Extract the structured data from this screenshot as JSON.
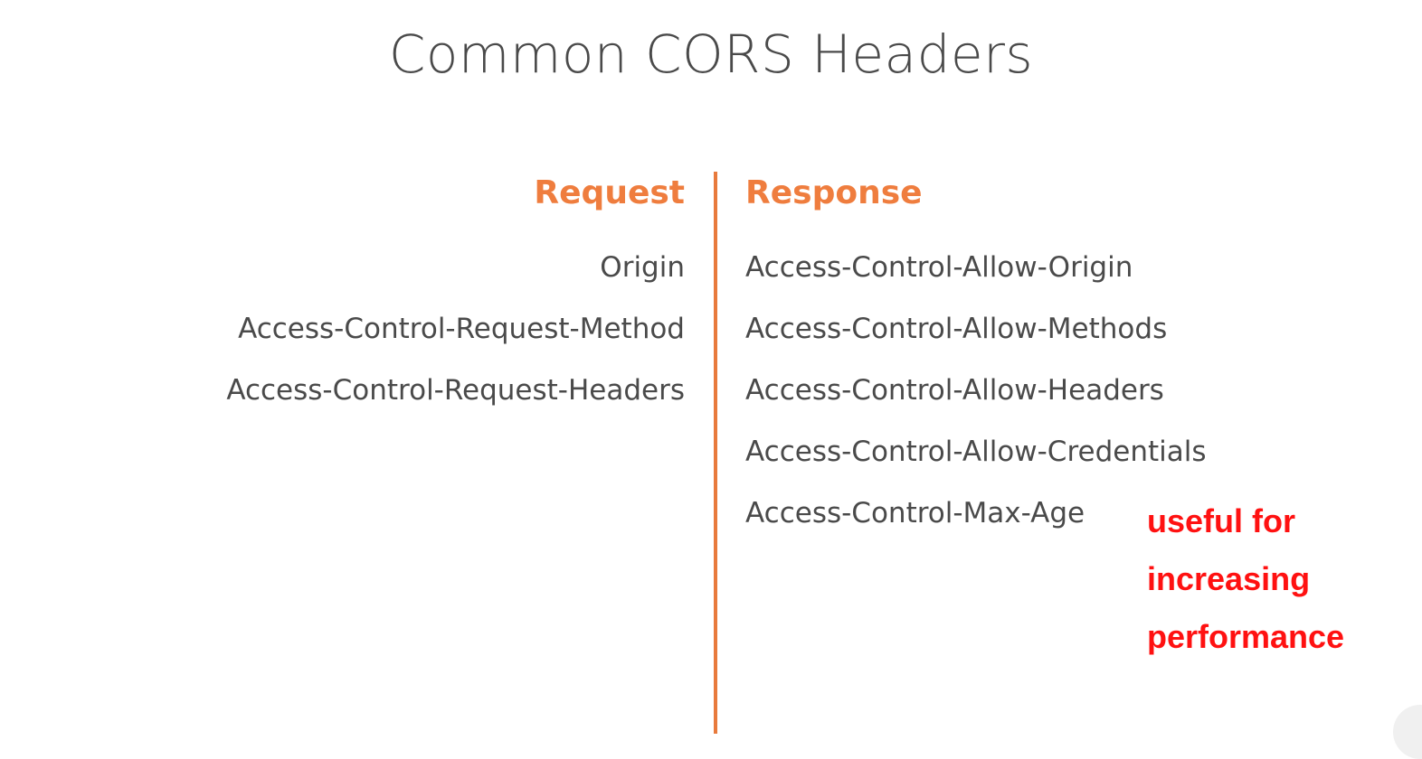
{
  "title": "Common CORS Headers",
  "request": {
    "heading": "Request",
    "items": [
      "Origin",
      "Access-Control-Request-Method",
      "Access-Control-Request-Headers"
    ]
  },
  "response": {
    "heading": "Response",
    "items": [
      "Access-Control-Allow-Origin",
      "Access-Control-Allow-Methods",
      "Access-Control-Allow-Headers",
      "Access-Control-Allow-Credentials",
      "Access-Control-Max-Age"
    ]
  },
  "annotation": {
    "lines": [
      "useful for",
      "increasing",
      "performance"
    ]
  },
  "colors": {
    "accent": "#ef7d3e",
    "text": "#4a4a4a",
    "annotation": "#ff1111"
  }
}
